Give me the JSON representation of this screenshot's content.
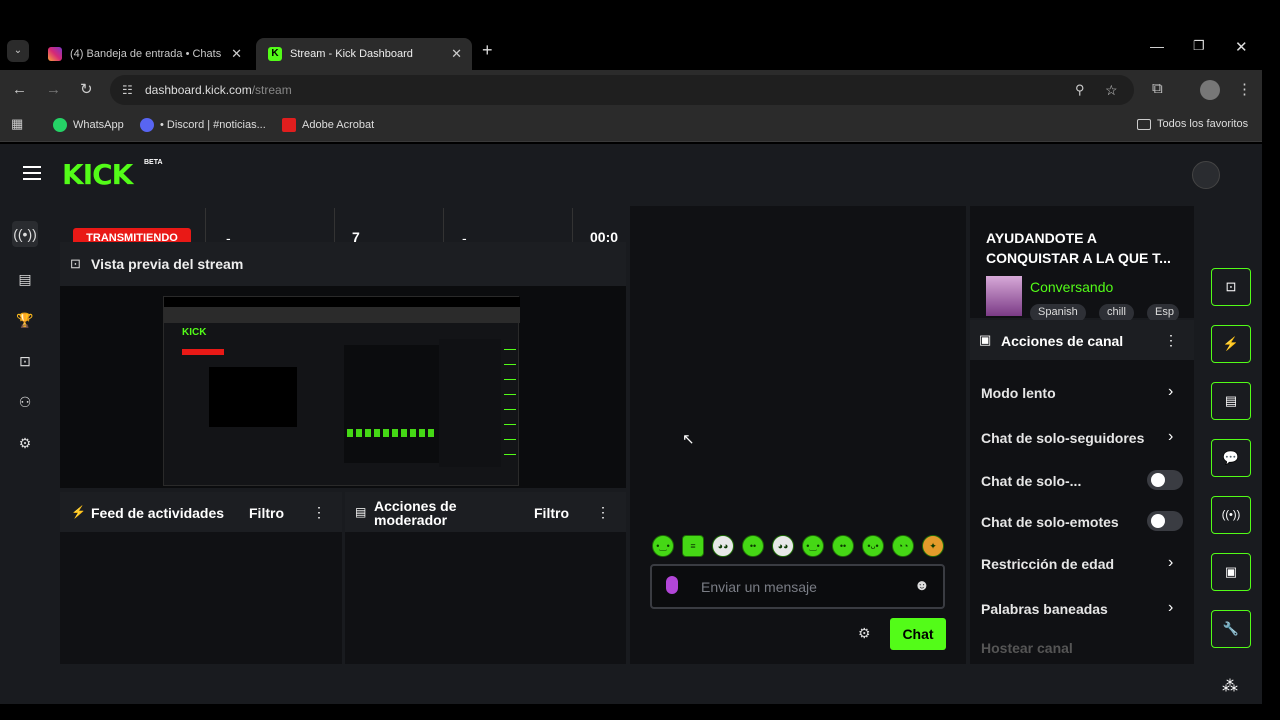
{
  "browser": {
    "tabs": [
      {
        "title": "(4) Bandeja de entrada • Chats"
      },
      {
        "title": "Stream - Kick Dashboard"
      }
    ],
    "url_domain": "dashboard.kick.com",
    "url_path": "/stream",
    "bookmarks": [
      "WhatsApp",
      "• Discord | #noticias...",
      "Adobe Acrobat"
    ],
    "all_bookmarks": "Todos los favoritos"
  },
  "header": {
    "logo": "KICK",
    "beta": "BETA"
  },
  "stats": {
    "status": "TRANSMITIENDO",
    "col2": "-",
    "col3": "7",
    "col4": "-",
    "col5": "00:0"
  },
  "preview": {
    "title": "Vista previa del stream"
  },
  "feed": {
    "title": "Feed de actividades",
    "filter": "Filtro"
  },
  "modactions": {
    "title_line1": "Acciones de",
    "title_line2": "moderador",
    "filter": "Filtro"
  },
  "chat": {
    "placeholder": "Enviar un mensaje",
    "send": "Chat"
  },
  "stream_info": {
    "title_line1": "AYUDANDOTE A",
    "title_line2": "CONQUISTAR A LA QUE T...",
    "category": "Conversando",
    "tags": [
      "Spanish",
      "chill",
      "Esp"
    ]
  },
  "channel_actions": {
    "title": "Acciones de canal",
    "items": [
      {
        "label": "Modo lento"
      },
      {
        "label": "Chat de solo-seguidores"
      },
      {
        "label": "Chat de solo-..."
      },
      {
        "label": "Chat de solo-emotes"
      },
      {
        "label": "Restricción de edad"
      },
      {
        "label": "Palabras baneadas"
      },
      {
        "label": "Hostear canal"
      }
    ]
  },
  "colors": {
    "accent": "#53fc18",
    "live": "#e91916",
    "panel": "#101114",
    "bg": "#191b1f"
  }
}
